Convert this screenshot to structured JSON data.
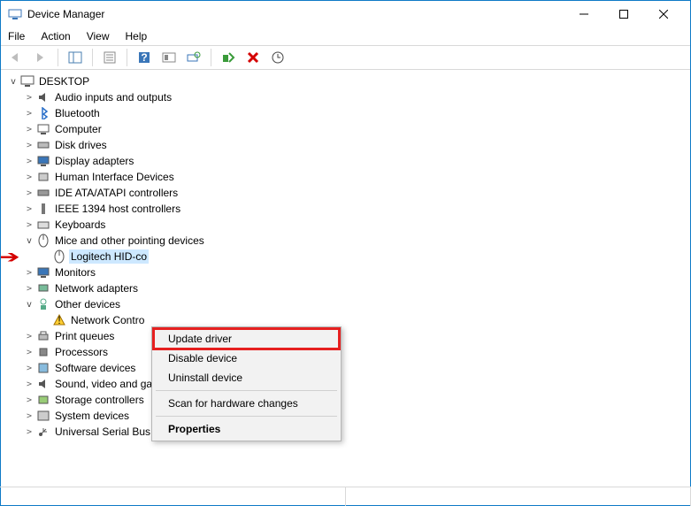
{
  "window": {
    "title": "Device Manager"
  },
  "menu": {
    "file": "File",
    "action": "Action",
    "view": "View",
    "help": "Help"
  },
  "tree": {
    "root": "DESKTOP",
    "items": [
      "Audio inputs and outputs",
      "Bluetooth",
      "Computer",
      "Disk drives",
      "Display adapters",
      "Human Interface Devices",
      "IDE ATA/ATAPI controllers",
      "IEEE 1394 host controllers",
      "Keyboards"
    ],
    "mice": {
      "label": "Mice and other pointing devices",
      "child": "Logitech HID-co"
    },
    "items2": [
      "Monitors",
      "Network adapters"
    ],
    "other": {
      "label": "Other devices",
      "child": "Network Contro"
    },
    "items3": [
      "Print queues",
      "Processors",
      "Software devices",
      "Sound, video and game controllers",
      "Storage controllers",
      "System devices",
      "Universal Serial Bus controllers"
    ]
  },
  "context": {
    "update": "Update driver",
    "disable": "Disable device",
    "uninstall": "Uninstall device",
    "scan": "Scan for hardware changes",
    "properties": "Properties"
  }
}
